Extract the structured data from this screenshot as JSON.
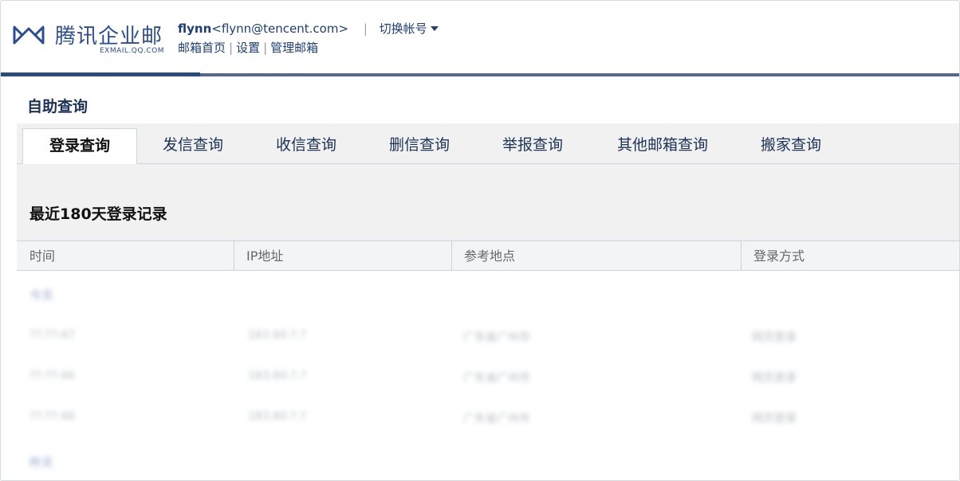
{
  "brand": {
    "name_cn": "腾讯企业邮",
    "name_en": "EXMAIL.QQ.COM",
    "color": "#2a4d94"
  },
  "account": {
    "username": "flynn",
    "email": "<flynn@tencent.com>",
    "separator": "|",
    "switch_label": "切换帐号"
  },
  "nav": {
    "home": "邮箱首页",
    "settings": "设置",
    "manage": "管理邮箱",
    "bar": "|"
  },
  "page_title": "自助查询",
  "tabs": [
    {
      "label": "登录查询",
      "active": true
    },
    {
      "label": "发信查询",
      "active": false
    },
    {
      "label": "收信查询",
      "active": false
    },
    {
      "label": "删信查询",
      "active": false
    },
    {
      "label": "举报查询",
      "active": false
    },
    {
      "label": "其他邮箱查询",
      "active": false
    },
    {
      "label": "搬家查询",
      "active": false
    }
  ],
  "section_title": "最近180天登录记录",
  "table": {
    "columns": [
      "时间",
      "IP地址",
      "参考地点",
      "登录方式"
    ],
    "group_label": "今天",
    "rows": [
      [
        "??:??:47",
        "183.60.?.?",
        "广东省广州市",
        "网页登录"
      ],
      [
        "??:??:46",
        "183.60.?.?",
        "广东省广州市",
        "网页登录"
      ],
      [
        "??:??:46",
        "183.60.?.?",
        "广东省广州市",
        "网页登录"
      ]
    ],
    "footer_label": "昨天"
  }
}
